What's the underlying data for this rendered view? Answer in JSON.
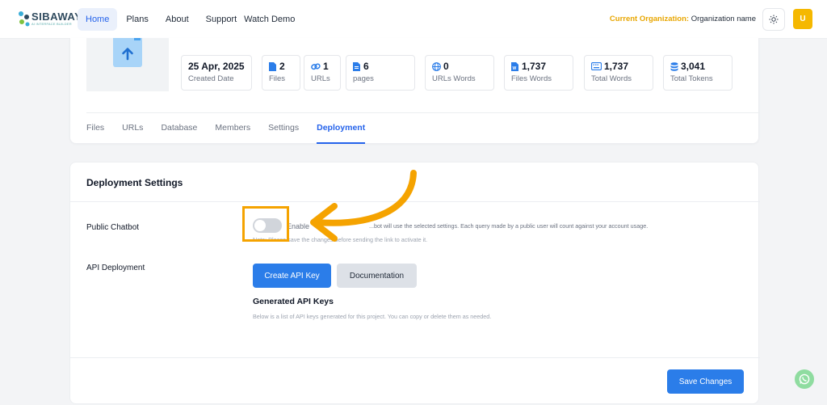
{
  "nav": {
    "logo_text": "SIBAWAY",
    "logo_tagline": "AI INTERFACE BUILDER",
    "links": [
      "Home",
      "Plans",
      "About",
      "Support",
      "Watch Demo"
    ],
    "active_link": "Home",
    "org_label": "Current Organization:",
    "org_name": "Organization name",
    "avatar_initial": "U"
  },
  "project": {
    "stats": [
      {
        "value": "25 Apr, 2025",
        "label": "Created Date",
        "icon": "none"
      },
      {
        "value": "2",
        "label": "Files",
        "icon": "file-icon"
      },
      {
        "value": "1",
        "label": "URLs",
        "icon": "link-icon"
      },
      {
        "value": "6",
        "label": "pages",
        "icon": "page-icon"
      },
      {
        "value": "0",
        "label": "URLs Words",
        "icon": "globe-icon"
      },
      {
        "value": "1,737",
        "label": "Files Words",
        "icon": "word-doc-icon"
      },
      {
        "value": "1,737",
        "label": "Total Words",
        "icon": "keyboard-icon"
      },
      {
        "value": "3,041",
        "label": "Total Tokens",
        "icon": "database-icon"
      }
    ],
    "tabs": [
      "Files",
      "URLs",
      "Database",
      "Members",
      "Settings",
      "Deployment"
    ],
    "active_tab": "Deployment"
  },
  "deployment": {
    "title": "Deployment Settings",
    "public_chatbot_label": "Public Chatbot",
    "toggle_label": "Enable",
    "toggle_description": "...bot will use the selected settings. Each query made by a public user will count against your account usage.",
    "note": "Note: Please save the changes before sending the link to activate it.",
    "api_label": "API Deployment",
    "create_key_button": "Create API Key",
    "docs_button": "Documentation",
    "keys_title": "Generated API Keys",
    "keys_description": "Below is a list of API keys generated for this project. You can copy or delete them as needed.",
    "save_button": "Save Changes",
    "public_chatbot_enabled": false
  },
  "colors": {
    "accent": "#2b7de9",
    "annotation": "#f5a300",
    "org_label": "#e8a600"
  }
}
